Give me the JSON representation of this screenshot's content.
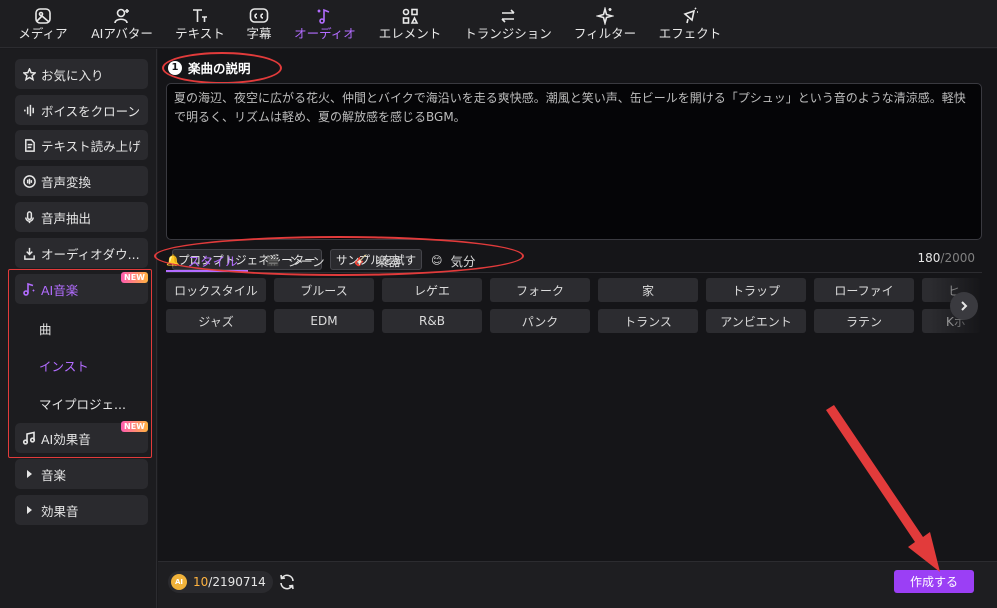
{
  "toolbar": {
    "items": [
      {
        "label": "メディア",
        "icon": "media-icon"
      },
      {
        "label": "AIアバター",
        "icon": "avatar-icon"
      },
      {
        "label": "テキスト",
        "icon": "text-icon"
      },
      {
        "label": "字幕",
        "icon": "caption-icon"
      },
      {
        "label": "オーディオ",
        "icon": "audio-icon",
        "active": true
      },
      {
        "label": "エレメント",
        "icon": "element-icon"
      },
      {
        "label": "トランジション",
        "icon": "transition-icon"
      },
      {
        "label": "フィルター",
        "icon": "filter-icon"
      },
      {
        "label": "エフェクト",
        "icon": "effect-icon"
      }
    ]
  },
  "sidebar": {
    "items": [
      {
        "label": "お気に入り",
        "icon": "star-icon"
      },
      {
        "label": "ボイスをクローン",
        "icon": "waveform-icon"
      },
      {
        "label": "テキスト読み上げ",
        "icon": "text-to-speech-icon"
      },
      {
        "label": "音声変換",
        "icon": "voice-change-icon"
      },
      {
        "label": "音声抽出",
        "icon": "microphone-icon"
      },
      {
        "label": "オーディオダウ...",
        "icon": "download-icon"
      },
      {
        "label": "AI音楽",
        "icon": "ai-music-icon",
        "badge": "NEW",
        "active": true
      },
      {
        "label": "AI効果音",
        "icon": "ai-sfx-icon",
        "badge": "NEW"
      },
      {
        "label": "音楽",
        "icon": "caret-right-icon"
      },
      {
        "label": "効果音",
        "icon": "caret-right-icon"
      }
    ],
    "sub_items": [
      {
        "label": "曲"
      },
      {
        "label": "インスト",
        "active": true
      },
      {
        "label": "マイプロジェ..."
      }
    ]
  },
  "main": {
    "step_number": "1",
    "section_title": "楽曲の説明",
    "description": "夏の海辺、夜空に広がる花火、仲間とバイクで海沿いを走る爽快感。潮風と笑い声、缶ビールを開ける「プシュッ」という音のような清涼感。軽快で明るく、リズムは軽め、夏の解放感を感じるBGM。",
    "prompt_generator_label": "プロンプトジェネレーター",
    "try_sample_label": "サンプルを試す",
    "char_count": "180",
    "char_limit": "/2000",
    "tabs": [
      {
        "label": "スタイル",
        "icon": "🔔",
        "active": true
      },
      {
        "label": "シーン",
        "icon": "🎬"
      },
      {
        "label": "楽器",
        "icon": "🎸"
      },
      {
        "label": "気分",
        "icon": "😊"
      }
    ],
    "style_chips_row1": [
      "ロックスタイル",
      "ブルース",
      "レゲエ",
      "フォーク",
      "家",
      "トラップ",
      "ローファイ",
      "ヒ"
    ],
    "style_chips_row2": [
      "ジャズ",
      "EDM",
      "R&B",
      "パンク",
      "トランス",
      "アンビエント",
      "ラテン",
      "Kポ"
    ],
    "credits_used": "10",
    "credits_total": "/2190714",
    "coin_label": "AI",
    "create_label": "作成する"
  },
  "colors": {
    "accent": "#b26cff",
    "button": "#9b3ff5",
    "highlight_red": "#e23b3b"
  }
}
